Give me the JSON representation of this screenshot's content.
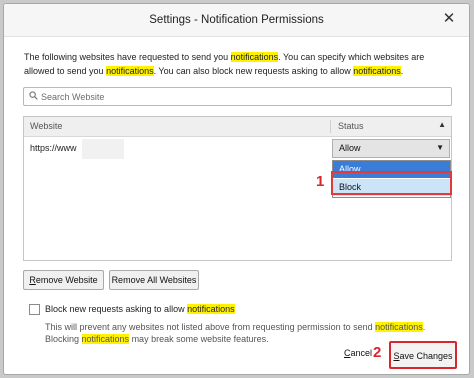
{
  "window": {
    "title": "Settings - Notification Permissions",
    "close_glyph": "✕"
  },
  "description": {
    "p1": "The following websites have requested to send you ",
    "h1": "notifications",
    "p2": ". You can specify which websites are allowed to send you ",
    "h2": "notifications",
    "p3": ". You can also block new requests asking to allow ",
    "h3": "notifications",
    "p4": "."
  },
  "search": {
    "icon": "search-icon",
    "placeholder": "Search Website"
  },
  "table": {
    "columns": {
      "website": "Website",
      "status": "Status",
      "sort_glyph": "▲"
    },
    "rows": [
      {
        "site": "https://www",
        "status": "Allow"
      }
    ],
    "dropdown_caret": "▼"
  },
  "dropdown": {
    "options": [
      "Allow",
      "Block"
    ],
    "highlighted": "Allow",
    "hovered": "Block"
  },
  "annotations": {
    "step1": "1",
    "step2": "2",
    "accent_color": "#d8262d"
  },
  "buttons": {
    "remove_mnemonic": "R",
    "remove_rest": "emove Website",
    "remove_all": "Remove All Websites",
    "cancel_mnemonic": "C",
    "cancel_rest": "ancel",
    "save_mnemonic": "S",
    "save_rest": "ave Changes"
  },
  "block_option": {
    "label_pre": "Block new requests asking to allow ",
    "label_hl": "notifications",
    "hint_a": "This will prevent any websites not listed above from requesting permission to send ",
    "hint_hl1": "notifications",
    "hint_b": ". Blocking ",
    "hint_hl2": "notifications",
    "hint_c": " may break some website features."
  },
  "highlight_color": "#fff200"
}
